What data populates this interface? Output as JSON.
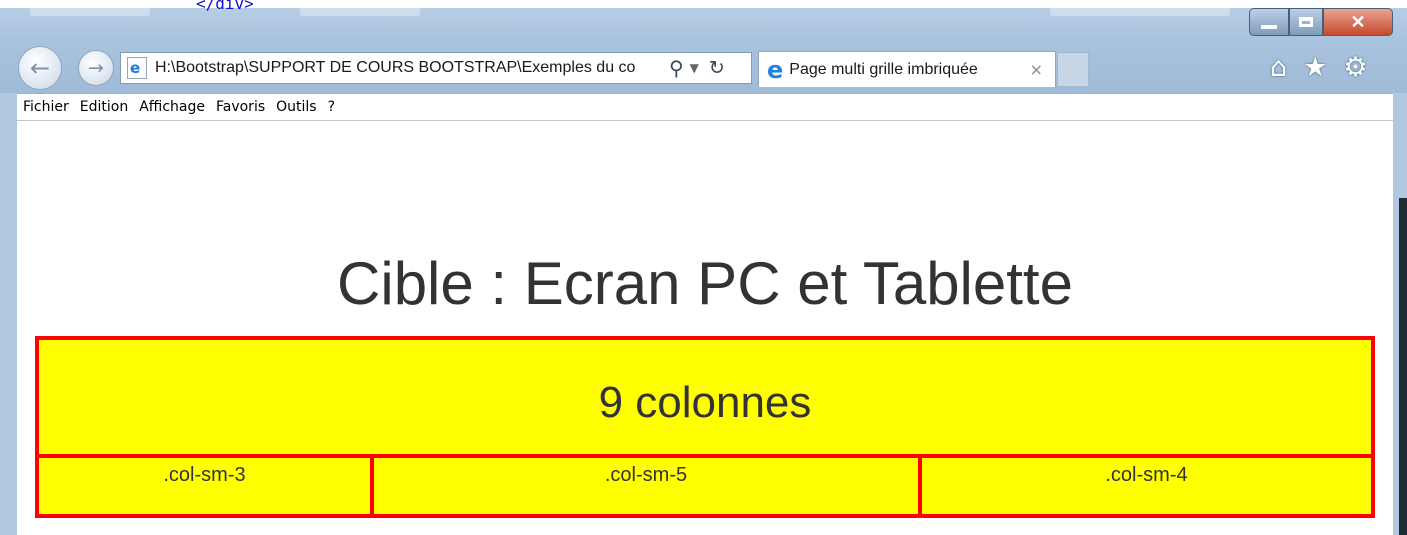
{
  "background_code": "</div>",
  "browser": {
    "address": "H:\\Bootstrap\\SUPPORT DE COURS BOOTSTRAP\\Exemples du co",
    "tab_title": "Page multi grille imbriquée",
    "tab_close": "×",
    "icons": {
      "back": "back-arrow-icon",
      "forward": "forward-arrow-icon",
      "search": "search-icon",
      "refresh": "refresh-icon",
      "home": "home-icon",
      "favorites": "star-icon",
      "settings": "gear-icon"
    },
    "colors": {
      "accent_close": "#c6492c",
      "frame": "#b1c8e0"
    }
  },
  "menu": {
    "items": [
      "Fichier",
      "Edition",
      "Affichage",
      "Favoris",
      "Outils",
      "?"
    ]
  },
  "page": {
    "title": "Cible : Ecran PC et Tablette",
    "outer_label": "9 colonnes",
    "columns": [
      ".col-sm-3",
      ".col-sm-5",
      ".col-sm-4"
    ],
    "colors": {
      "column_fill": "#ffff00",
      "column_border": "#ff0000",
      "text": "#333333"
    }
  }
}
